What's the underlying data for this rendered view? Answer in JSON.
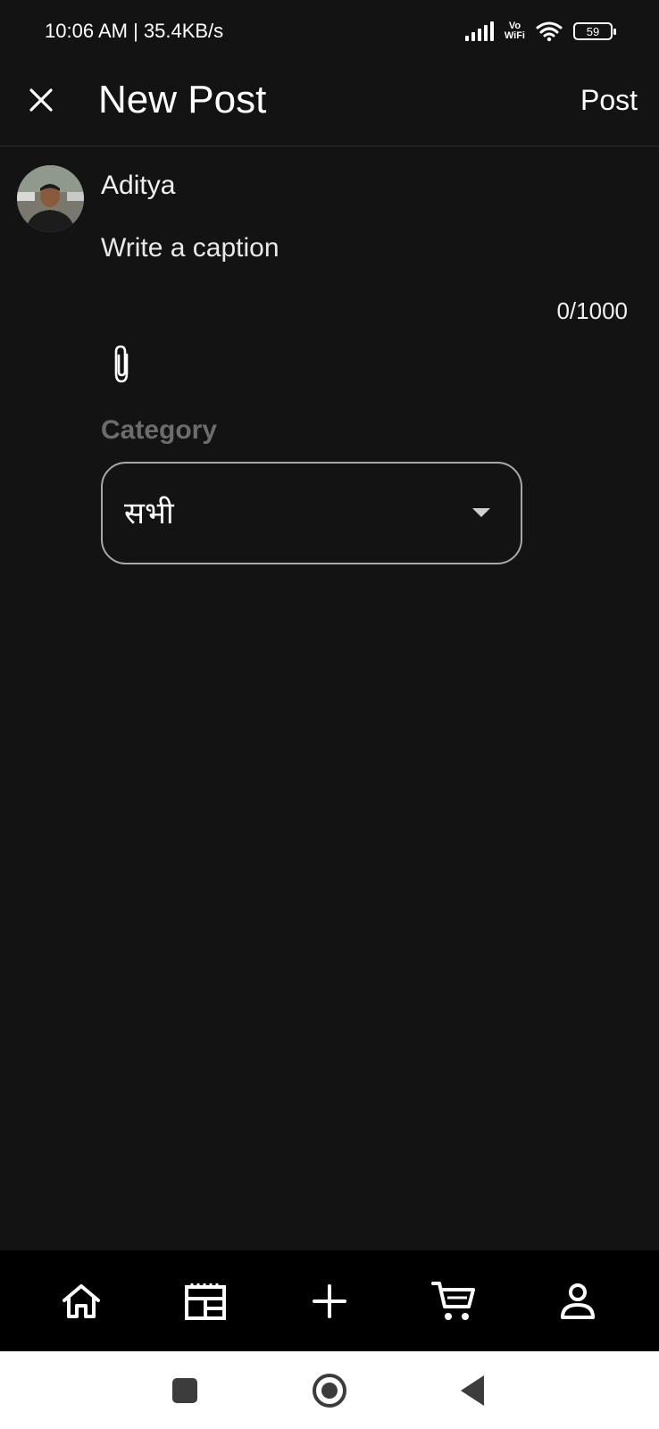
{
  "status_bar": {
    "time_speed": "10:06 AM | 35.4KB/s",
    "vowifi_top": "Vo",
    "vowifi_bottom": "WiFi",
    "battery": "59"
  },
  "app_bar": {
    "title": "New Post",
    "post_label": "Post"
  },
  "composer": {
    "user_name": "Aditya",
    "caption_placeholder": "Write a caption",
    "char_count": "0/1000"
  },
  "category": {
    "label": "Category",
    "selected": "सभी"
  },
  "bottom_nav": {
    "items": [
      {
        "icon": "home-icon"
      },
      {
        "icon": "feed-icon"
      },
      {
        "icon": "plus-icon"
      },
      {
        "icon": "cart-icon"
      },
      {
        "icon": "profile-icon"
      }
    ]
  },
  "colors": {
    "background": "#131313",
    "nav_background": "#000000",
    "label_muted": "#6c6c6c",
    "dropdown_border": "#a8a8a8"
  }
}
